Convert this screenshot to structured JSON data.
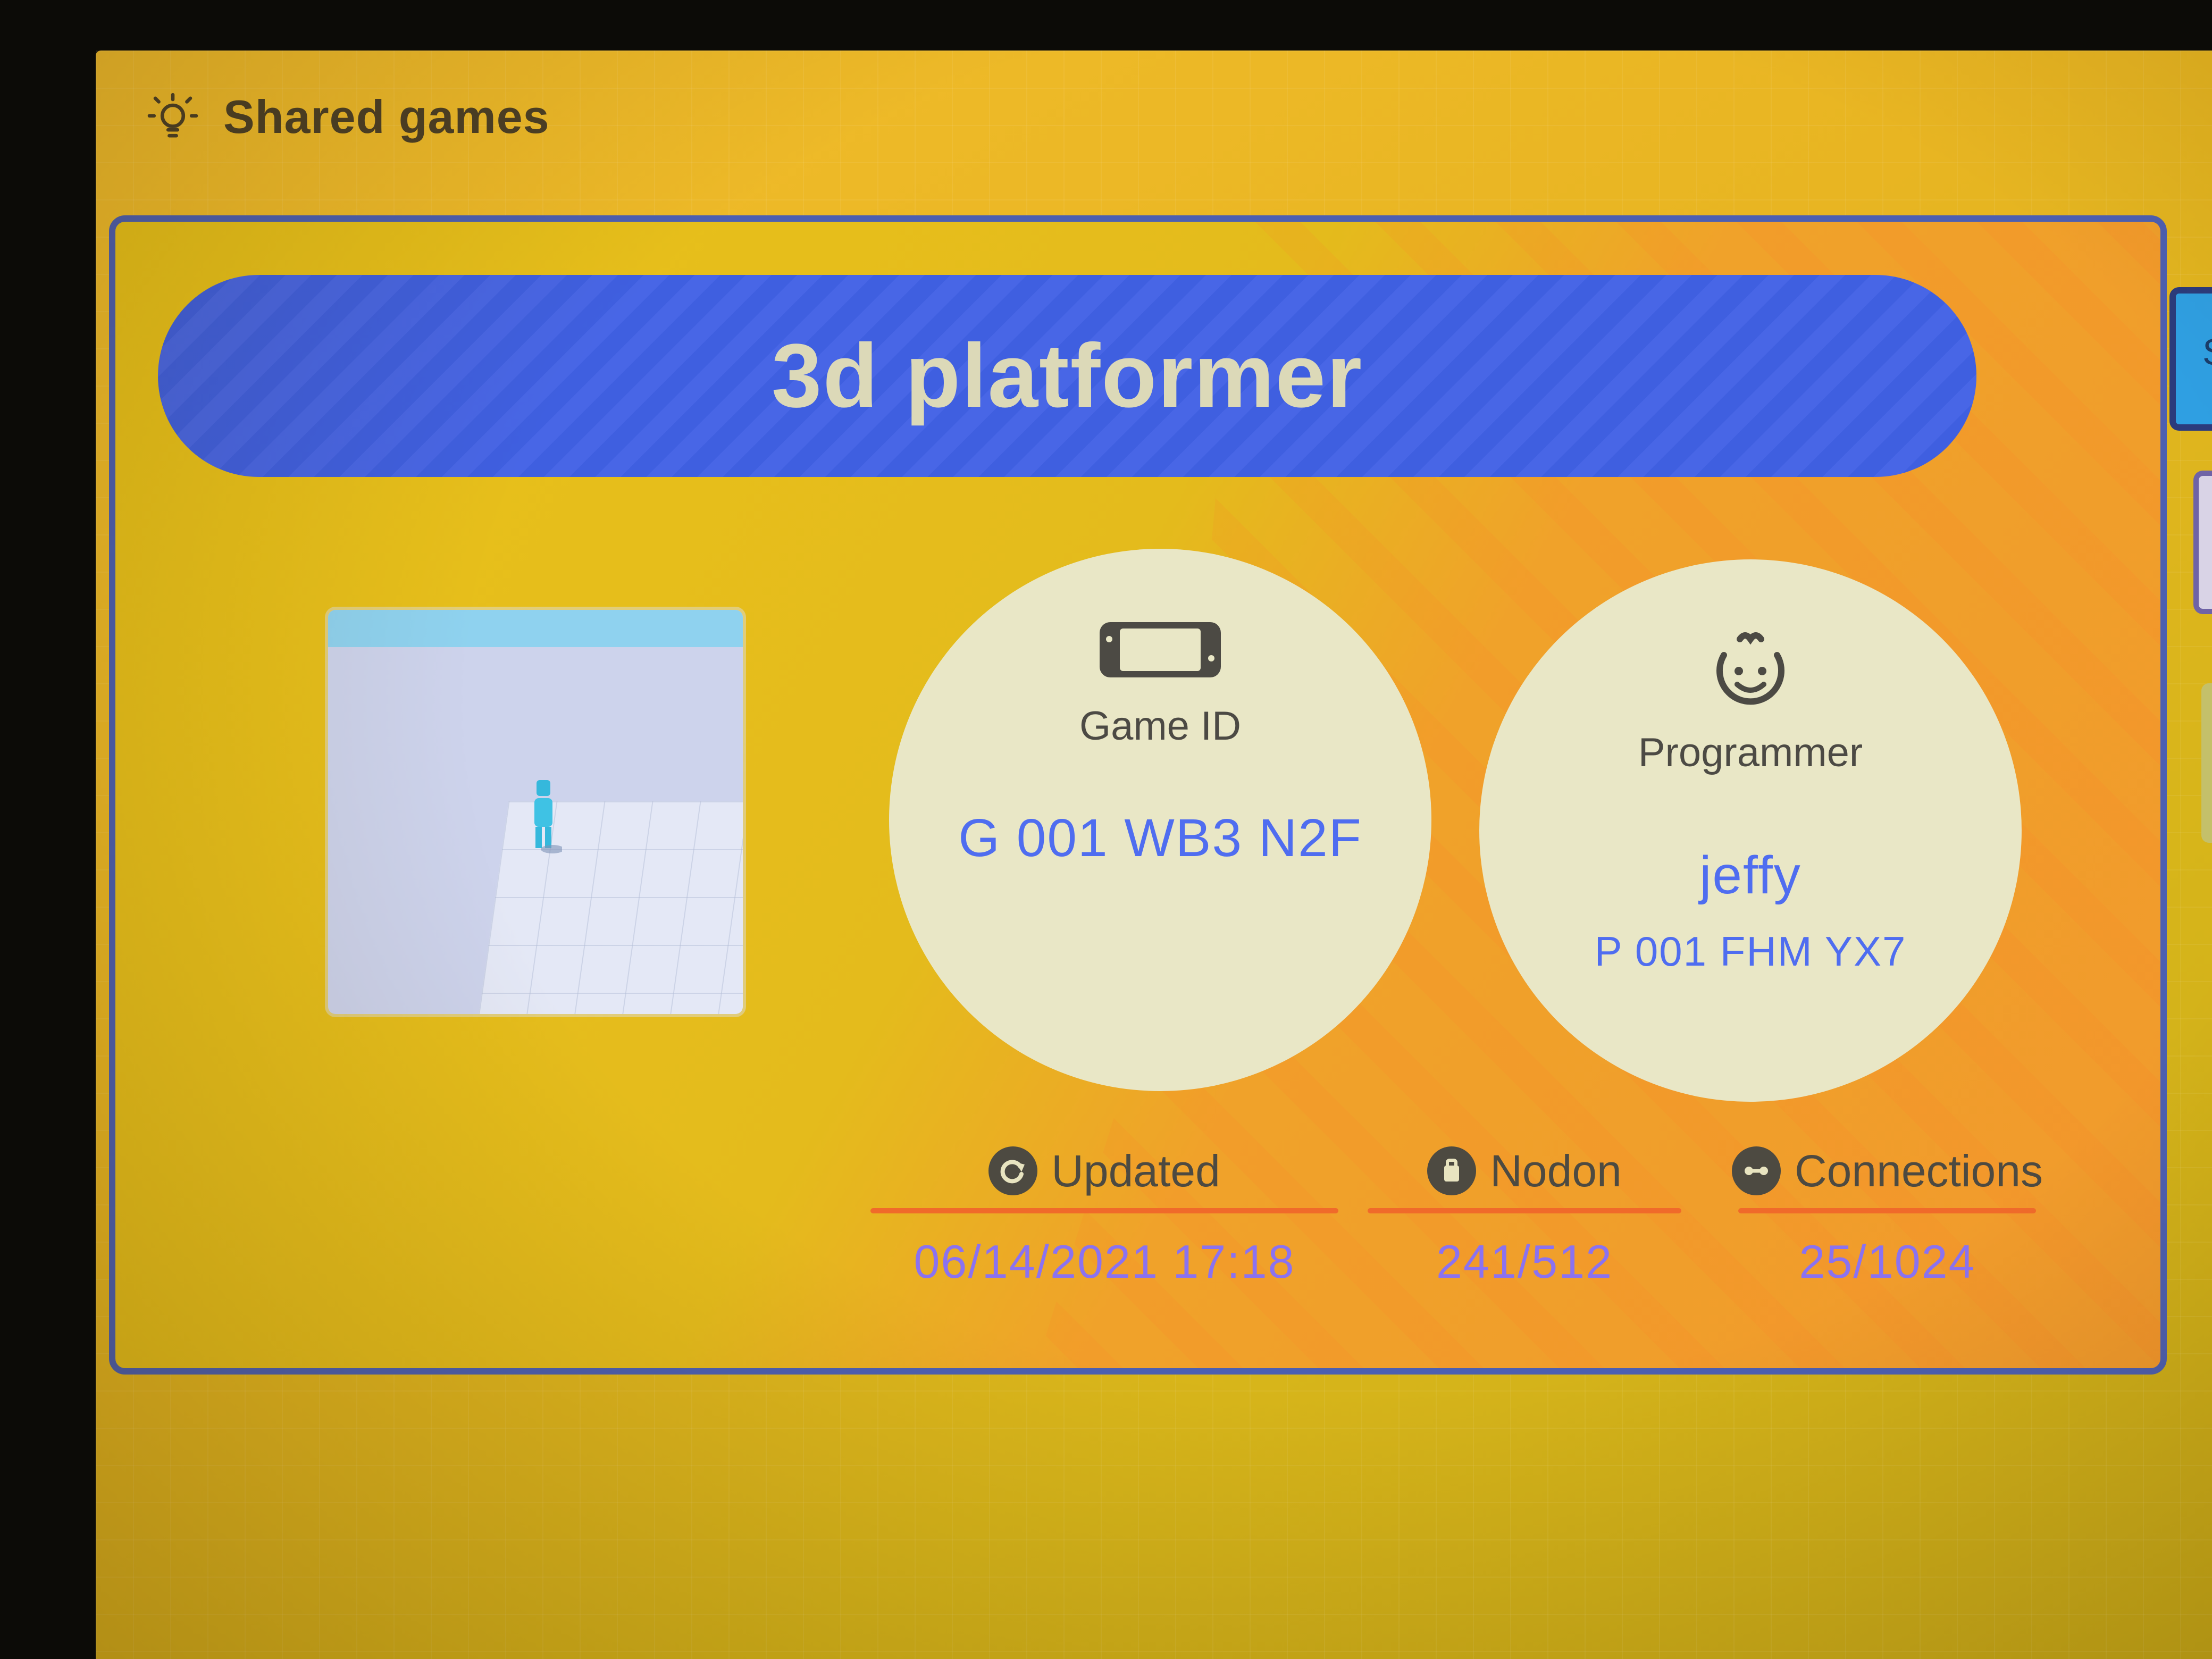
{
  "header": {
    "title": "Shared games",
    "icon": "lightbulb-icon"
  },
  "game": {
    "title": "3d platformer",
    "thumbnail_alt": "game-thumbnail"
  },
  "game_id": {
    "label": "Game ID",
    "value": "G 001 WB3 N2F",
    "icon": "console-icon"
  },
  "programmer": {
    "label": "Programmer",
    "name": "jeffy",
    "id": "P 001 FHM YX7",
    "icon": "face-icon"
  },
  "stats": {
    "updated": {
      "label": "Updated",
      "value": "06/14/2021 17:18",
      "icon": "refresh-icon"
    },
    "nodon": {
      "label": "Nodon",
      "value": "241/512",
      "icon": "nodon-icon"
    },
    "connections": {
      "label": "Connections",
      "value": "25/1024",
      "icon": "link-icon"
    }
  },
  "side_tabs": {
    "first_letter": "S"
  },
  "colors": {
    "background": "#e8b522",
    "banner": "#4866e6",
    "circle": "#e9e7c6",
    "accent_text": "#4f6df0",
    "stat_value": "#8b72f0",
    "underline": "#f06a2a",
    "card_border": "#4c5fb1"
  }
}
